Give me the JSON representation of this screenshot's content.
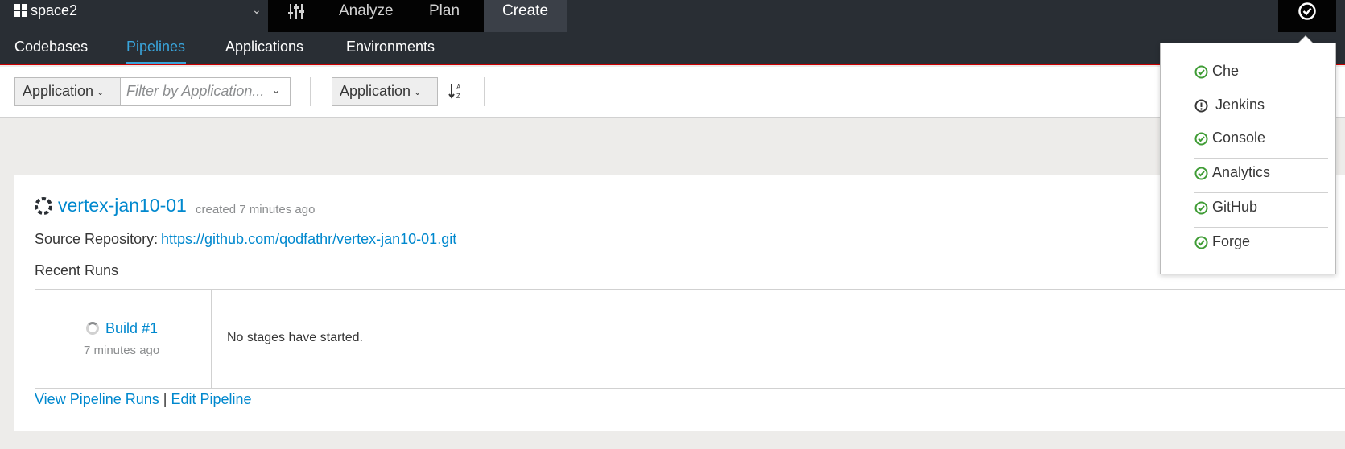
{
  "header": {
    "space_name": "space2",
    "nav": [
      "Analyze",
      "Plan",
      "Create"
    ],
    "active_nav": "Create"
  },
  "subnav": {
    "items": [
      "Codebases",
      "Pipelines",
      "Applications",
      "Environments"
    ],
    "active": "Pipelines"
  },
  "toolbar": {
    "filter_field": "Application",
    "filter_placeholder": "Filter by Application...",
    "sort_field": "Application",
    "sort_icon": "sort-alpha-asc-icon"
  },
  "pipeline": {
    "name": "vertex-jan10-01",
    "created": "created 7 minutes ago",
    "source_label": "Source Repository:",
    "source_url": "https://github.com/qodfathr/vertex-jan10-01.git",
    "recent_runs_label": "Recent Runs",
    "run": {
      "build": "Build #1",
      "time": "7 minutes ago",
      "stages_message": "No stages have started."
    },
    "links": {
      "view_runs": "View Pipeline Runs",
      "separator": "|",
      "edit": "Edit Pipeline"
    }
  },
  "status_menu": {
    "items": [
      {
        "label": "Che",
        "status": "ok"
      },
      {
        "label": "Jenkins",
        "status": "warning"
      },
      {
        "label": "Console",
        "status": "ok"
      },
      {
        "label": "Analytics",
        "status": "ok"
      },
      {
        "label": "GitHub",
        "status": "ok"
      },
      {
        "label": "Forge",
        "status": "ok"
      }
    ]
  },
  "colors": {
    "ok": "#3f9c35",
    "warning": "#363636",
    "link": "#0088ce",
    "active_tab": "#39a5dc",
    "accent_border": "#cc0000"
  }
}
